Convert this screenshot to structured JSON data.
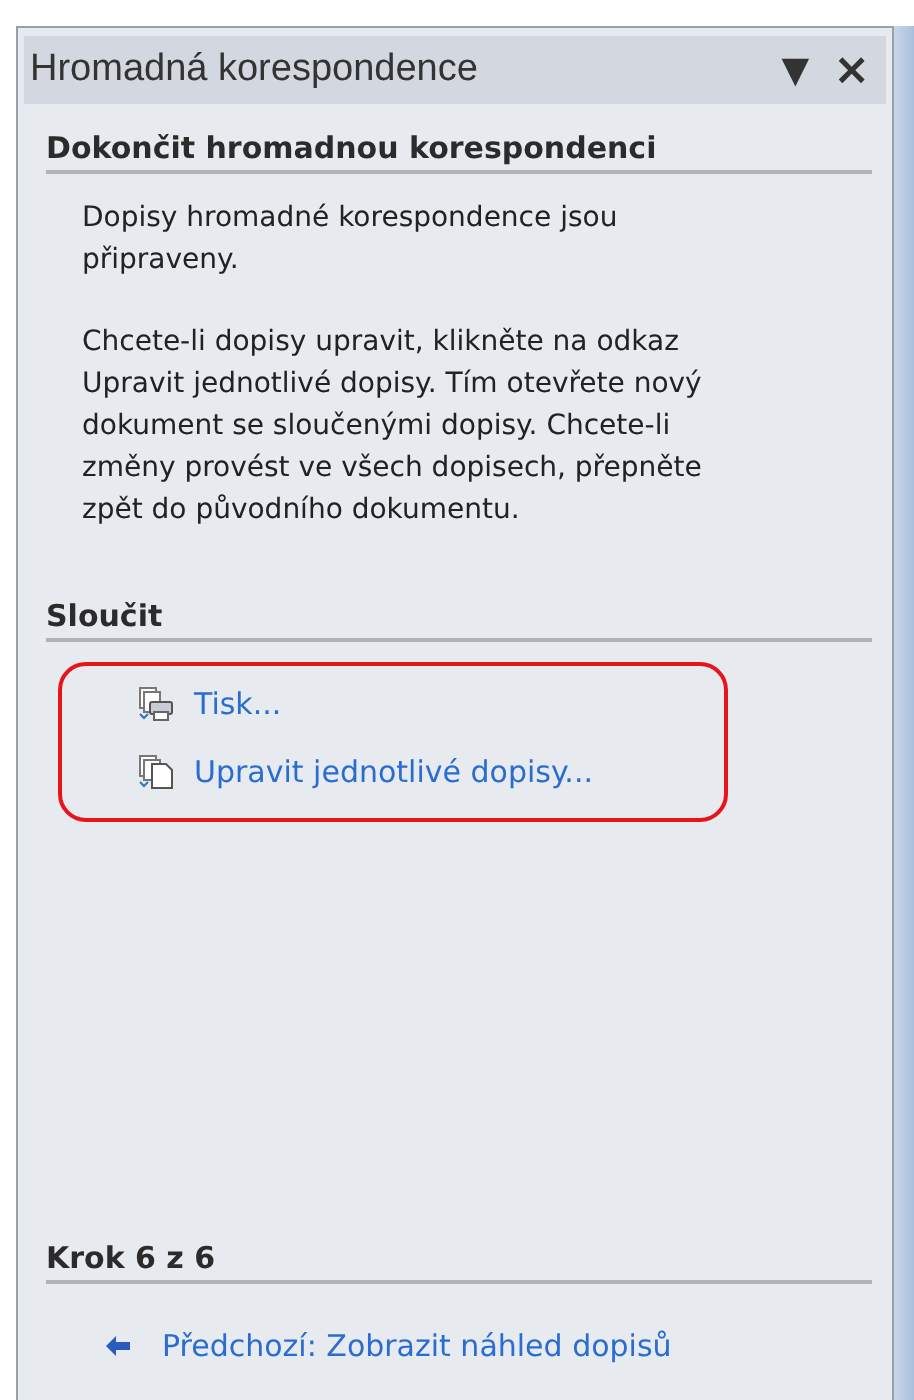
{
  "pane": {
    "title": "Hromadná korespondence",
    "menu_glyph": "▼",
    "close_glyph": "×"
  },
  "sections": [
    {
      "heading": "Dokončit hromadnou korespondenci",
      "paragraphs": [
        "Dopisy hromadné korespondence jsou připraveny.",
        "Chcete-li dopisy upravit, klikněte na odkaz Upravit jednotlivé dopisy. Tím otevřete nový dokument se sloučenými dopisy. Chcete-li změny provést ve všech dopisech, přepněte zpět do původního dokumentu."
      ]
    },
    {
      "heading": "Sloučit",
      "highlighted": true,
      "links": [
        {
          "label": "Tisk...",
          "kind": "print"
        },
        {
          "label": "Upravit jednotlivé dopisy...",
          "kind": "edit"
        }
      ]
    }
  ],
  "step": {
    "heading": "Krok 6 z 6",
    "links": [
      {
        "label": "Předchozí: Zobrazit náhled dopisů",
        "kind": "back"
      }
    ]
  }
}
